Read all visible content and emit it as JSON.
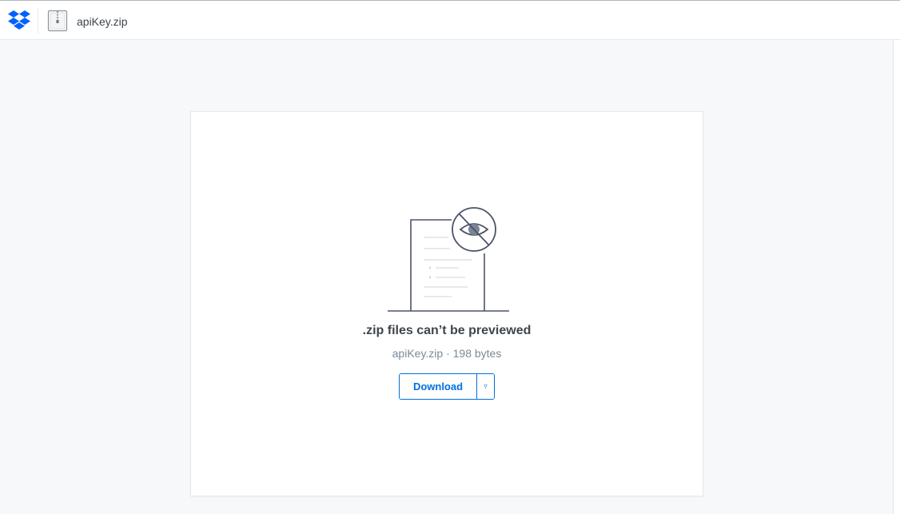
{
  "header": {
    "file_name": "apiKey.zip",
    "logo_icon": "dropbox-logo-icon",
    "file_type_icon": "zip-file-icon"
  },
  "preview": {
    "title": ".zip files can’t be previewed",
    "meta": "apiKey.zip · 198 bytes",
    "illustration_icon": "document-hidden-eye-illustration"
  },
  "actions": {
    "download_label": "Download",
    "download_caret": "▿",
    "caret_icon": "chevron-down-icon"
  },
  "colors": {
    "brand_blue": "#0061fe",
    "button_blue": "#0070e0",
    "page_background": "#f6f8fa",
    "text_primary": "#3d464d",
    "text_secondary": "#7b8994",
    "illustration_stroke": "#4b5468"
  }
}
